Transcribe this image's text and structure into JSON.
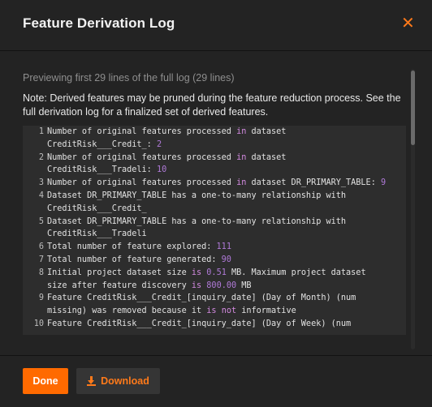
{
  "modal": {
    "title": "Feature Derivation Log",
    "close_icon": "close-icon",
    "preview_text": "Previewing first 29 lines of the full log (29 lines)",
    "note_text": "Note: Derived features may be pruned during the feature reduction process. See the full derivation log for a finalized set of derived features."
  },
  "log": [
    {
      "num": "1",
      "text": [
        {
          "t": "Number of original features processed "
        },
        {
          "t": "in",
          "k": "kw"
        },
        {
          "t": " dataset"
        }
      ]
    },
    {
      "num": "",
      "text": [
        {
          "t": "CreditRisk___Credit_: "
        },
        {
          "t": "2",
          "k": "n"
        }
      ]
    },
    {
      "num": "2",
      "text": [
        {
          "t": "Number of original features processed "
        },
        {
          "t": "in",
          "k": "kw"
        },
        {
          "t": " dataset"
        }
      ]
    },
    {
      "num": "",
      "text": [
        {
          "t": "CreditRisk___Tradeli: "
        },
        {
          "t": "10",
          "k": "n"
        }
      ]
    },
    {
      "num": "3",
      "text": [
        {
          "t": "Number of original features processed "
        },
        {
          "t": "in",
          "k": "kw"
        },
        {
          "t": " dataset DR_PRIMARY_TABLE: "
        },
        {
          "t": "9",
          "k": "n"
        }
      ]
    },
    {
      "num": "4",
      "text": [
        {
          "t": "Dataset DR_PRIMARY_TABLE has a one-to-many relationship with"
        }
      ]
    },
    {
      "num": "",
      "text": [
        {
          "t": "CreditRisk___Credit_"
        }
      ]
    },
    {
      "num": "5",
      "text": [
        {
          "t": "Dataset DR_PRIMARY_TABLE has a one-to-many relationship with"
        }
      ]
    },
    {
      "num": "",
      "text": [
        {
          "t": "CreditRisk___Tradeli"
        }
      ]
    },
    {
      "num": "6",
      "text": [
        {
          "t": "Total number of feature explored: "
        },
        {
          "t": "111",
          "k": "n"
        }
      ]
    },
    {
      "num": "7",
      "text": [
        {
          "t": "Total number of feature generated: "
        },
        {
          "t": "90",
          "k": "n"
        }
      ]
    },
    {
      "num": "8",
      "text": [
        {
          "t": "Initial project dataset size "
        },
        {
          "t": "is",
          "k": "kw"
        },
        {
          "t": " "
        },
        {
          "t": "0.51",
          "k": "n"
        },
        {
          "t": " MB. Maximum project dataset"
        }
      ]
    },
    {
      "num": "",
      "text": [
        {
          "t": "size after feature discovery "
        },
        {
          "t": "is",
          "k": "kw"
        },
        {
          "t": " "
        },
        {
          "t": "800.00",
          "k": "n"
        },
        {
          "t": " MB"
        }
      ]
    },
    {
      "num": "9",
      "text": [
        {
          "t": "Feature CreditRisk___Credit_[inquiry_date] (Day of Month) (num"
        }
      ]
    },
    {
      "num": "",
      "text": [
        {
          "t": "missing) was removed because it "
        },
        {
          "t": "is",
          "k": "kw"
        },
        {
          "t": " "
        },
        {
          "t": "not",
          "k": "kw"
        },
        {
          "t": " informative"
        }
      ]
    },
    {
      "num": "10",
      "text": [
        {
          "t": "Feature CreditRisk___Credit_[inquiry_date] (Day of Week) (num"
        }
      ]
    }
  ],
  "footer": {
    "done_label": "Done",
    "download_label": "Download",
    "download_icon": "download-icon"
  },
  "colors": {
    "accent": "#ff6a00",
    "keyword": "#d38ae0",
    "number": "#b07ad8",
    "background": "#232323",
    "log_background": "#2d2d2d"
  }
}
